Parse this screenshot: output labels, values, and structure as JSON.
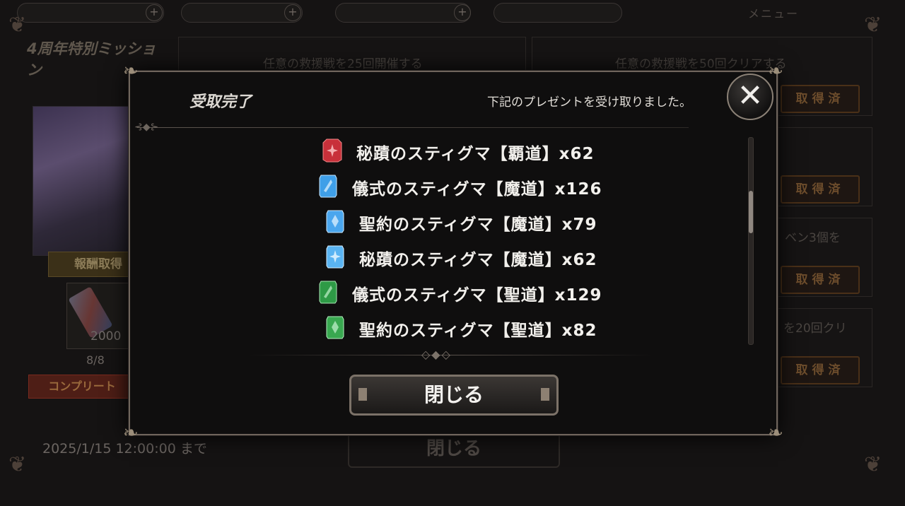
{
  "background": {
    "topbar": {
      "menu_label": "メニュー"
    },
    "mission_title": "4周年特別ミッション",
    "missions": [
      {
        "text": "任意の救援戦を25回開催する",
        "button": "取得済"
      },
      {
        "text": "任意の救援戦を50回クリアする",
        "button": "取得済"
      },
      {
        "text": "",
        "button": "取得済"
      },
      {
        "text": "ベン3個を",
        "button": "取得済"
      },
      {
        "text": "を20回クリ",
        "button": "取得済"
      }
    ],
    "reward_label": "報酬取得",
    "reward_count": "2000",
    "progress": "8/8",
    "complete_label": "コンプリート",
    "deadline": "2025/1/15 12:00:00 まで",
    "ghost_close": "閉じる"
  },
  "modal": {
    "title": "受取完了",
    "message": "下記のプレゼントを受け取りました。",
    "close_icon": "close-x-icon",
    "items": [
      {
        "label": "秘蹟のスティグマ【覇道】x62",
        "gem_color": "#c8303a"
      },
      {
        "label": "儀式のスティグマ【魔道】x126",
        "gem_color": "#3f9fe8"
      },
      {
        "label": "聖約のスティグマ【魔道】x79",
        "gem_color": "#4aa6ee"
      },
      {
        "label": "秘蹟のスティグマ【魔道】x62",
        "gem_color": "#5ab4f2"
      },
      {
        "label": "儀式のスティグマ【聖道】x129",
        "gem_color": "#2e9a46"
      },
      {
        "label": "聖約のスティグマ【聖道】x82",
        "gem_color": "#39a850"
      }
    ],
    "close_button": "閉じる"
  }
}
